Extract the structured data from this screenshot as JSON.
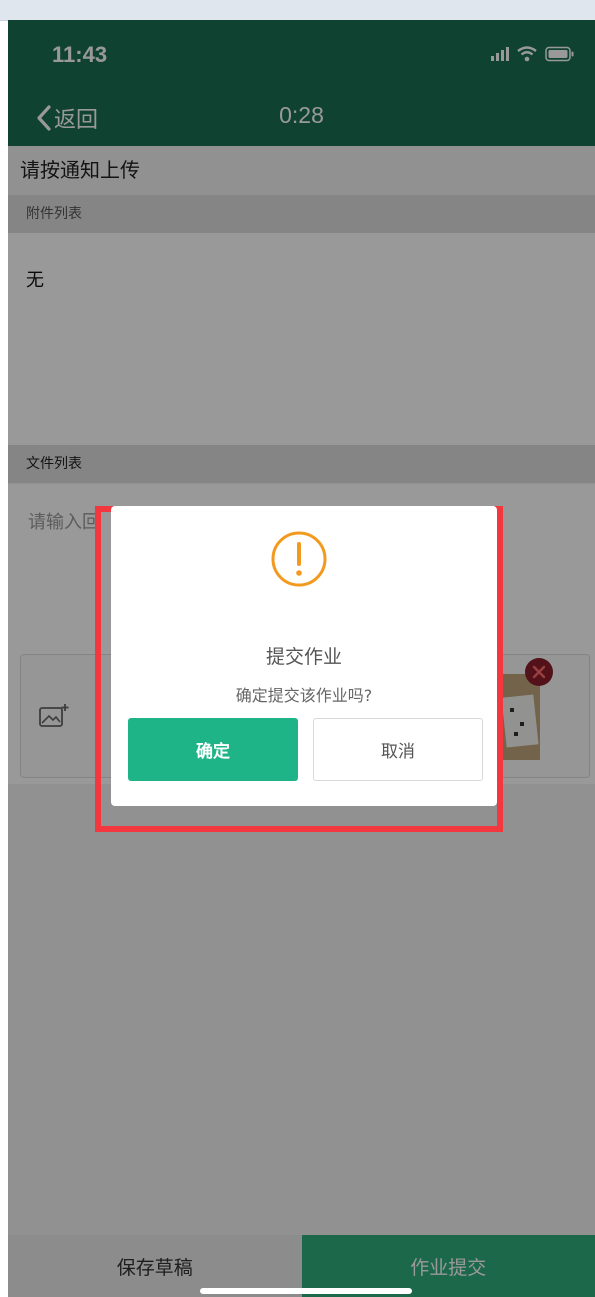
{
  "status_bar": {
    "time": "11:43"
  },
  "nav": {
    "back_label": "返回",
    "timer": "0:28"
  },
  "page": {
    "instruction": "请按通知上传",
    "attachments_header": "附件列表",
    "attachments_empty": "无",
    "files_header": "文件列表",
    "answer_placeholder": "请输入回"
  },
  "bottom_bar": {
    "save_draft": "保存草稿",
    "submit": "作业提交"
  },
  "dialog": {
    "icon": "exclamation-circle-icon",
    "title": "提交作业",
    "message": "确定提交该作业吗?",
    "confirm_label": "确定",
    "cancel_label": "取消"
  },
  "colors": {
    "header_green": "#1b6f54",
    "confirm_green": "#1fb487",
    "warning_orange": "#f39a1e",
    "highlight_red": "#f2373f"
  }
}
